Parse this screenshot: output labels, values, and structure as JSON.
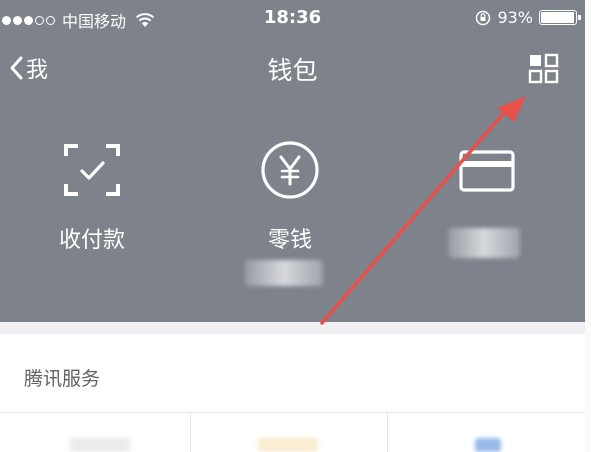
{
  "status_bar": {
    "signal_dots": [
      true,
      true,
      true,
      false,
      false
    ],
    "carrier": "中国移动",
    "wifi_icon": "wifi-icon",
    "time": "18:36",
    "lock_icon": "rotation-lock-icon",
    "battery_percent_text": "93%",
    "battery_level": 0.93
  },
  "nav": {
    "back_label": "我",
    "back_icon": "chevron-left-icon",
    "title": "钱包",
    "menu_icon": "grid-icon"
  },
  "actions": [
    {
      "label": "收付款",
      "icon": "scan-check-icon"
    },
    {
      "label": "零钱",
      "icon": "yuan-circle-icon"
    },
    {
      "label": "",
      "icon": "bank-card-icon"
    }
  ],
  "services": {
    "title": "腾讯服务"
  },
  "colors": {
    "header_bg": "#7e828b",
    "arrow": "#e8504c",
    "section_text": "#606266"
  }
}
